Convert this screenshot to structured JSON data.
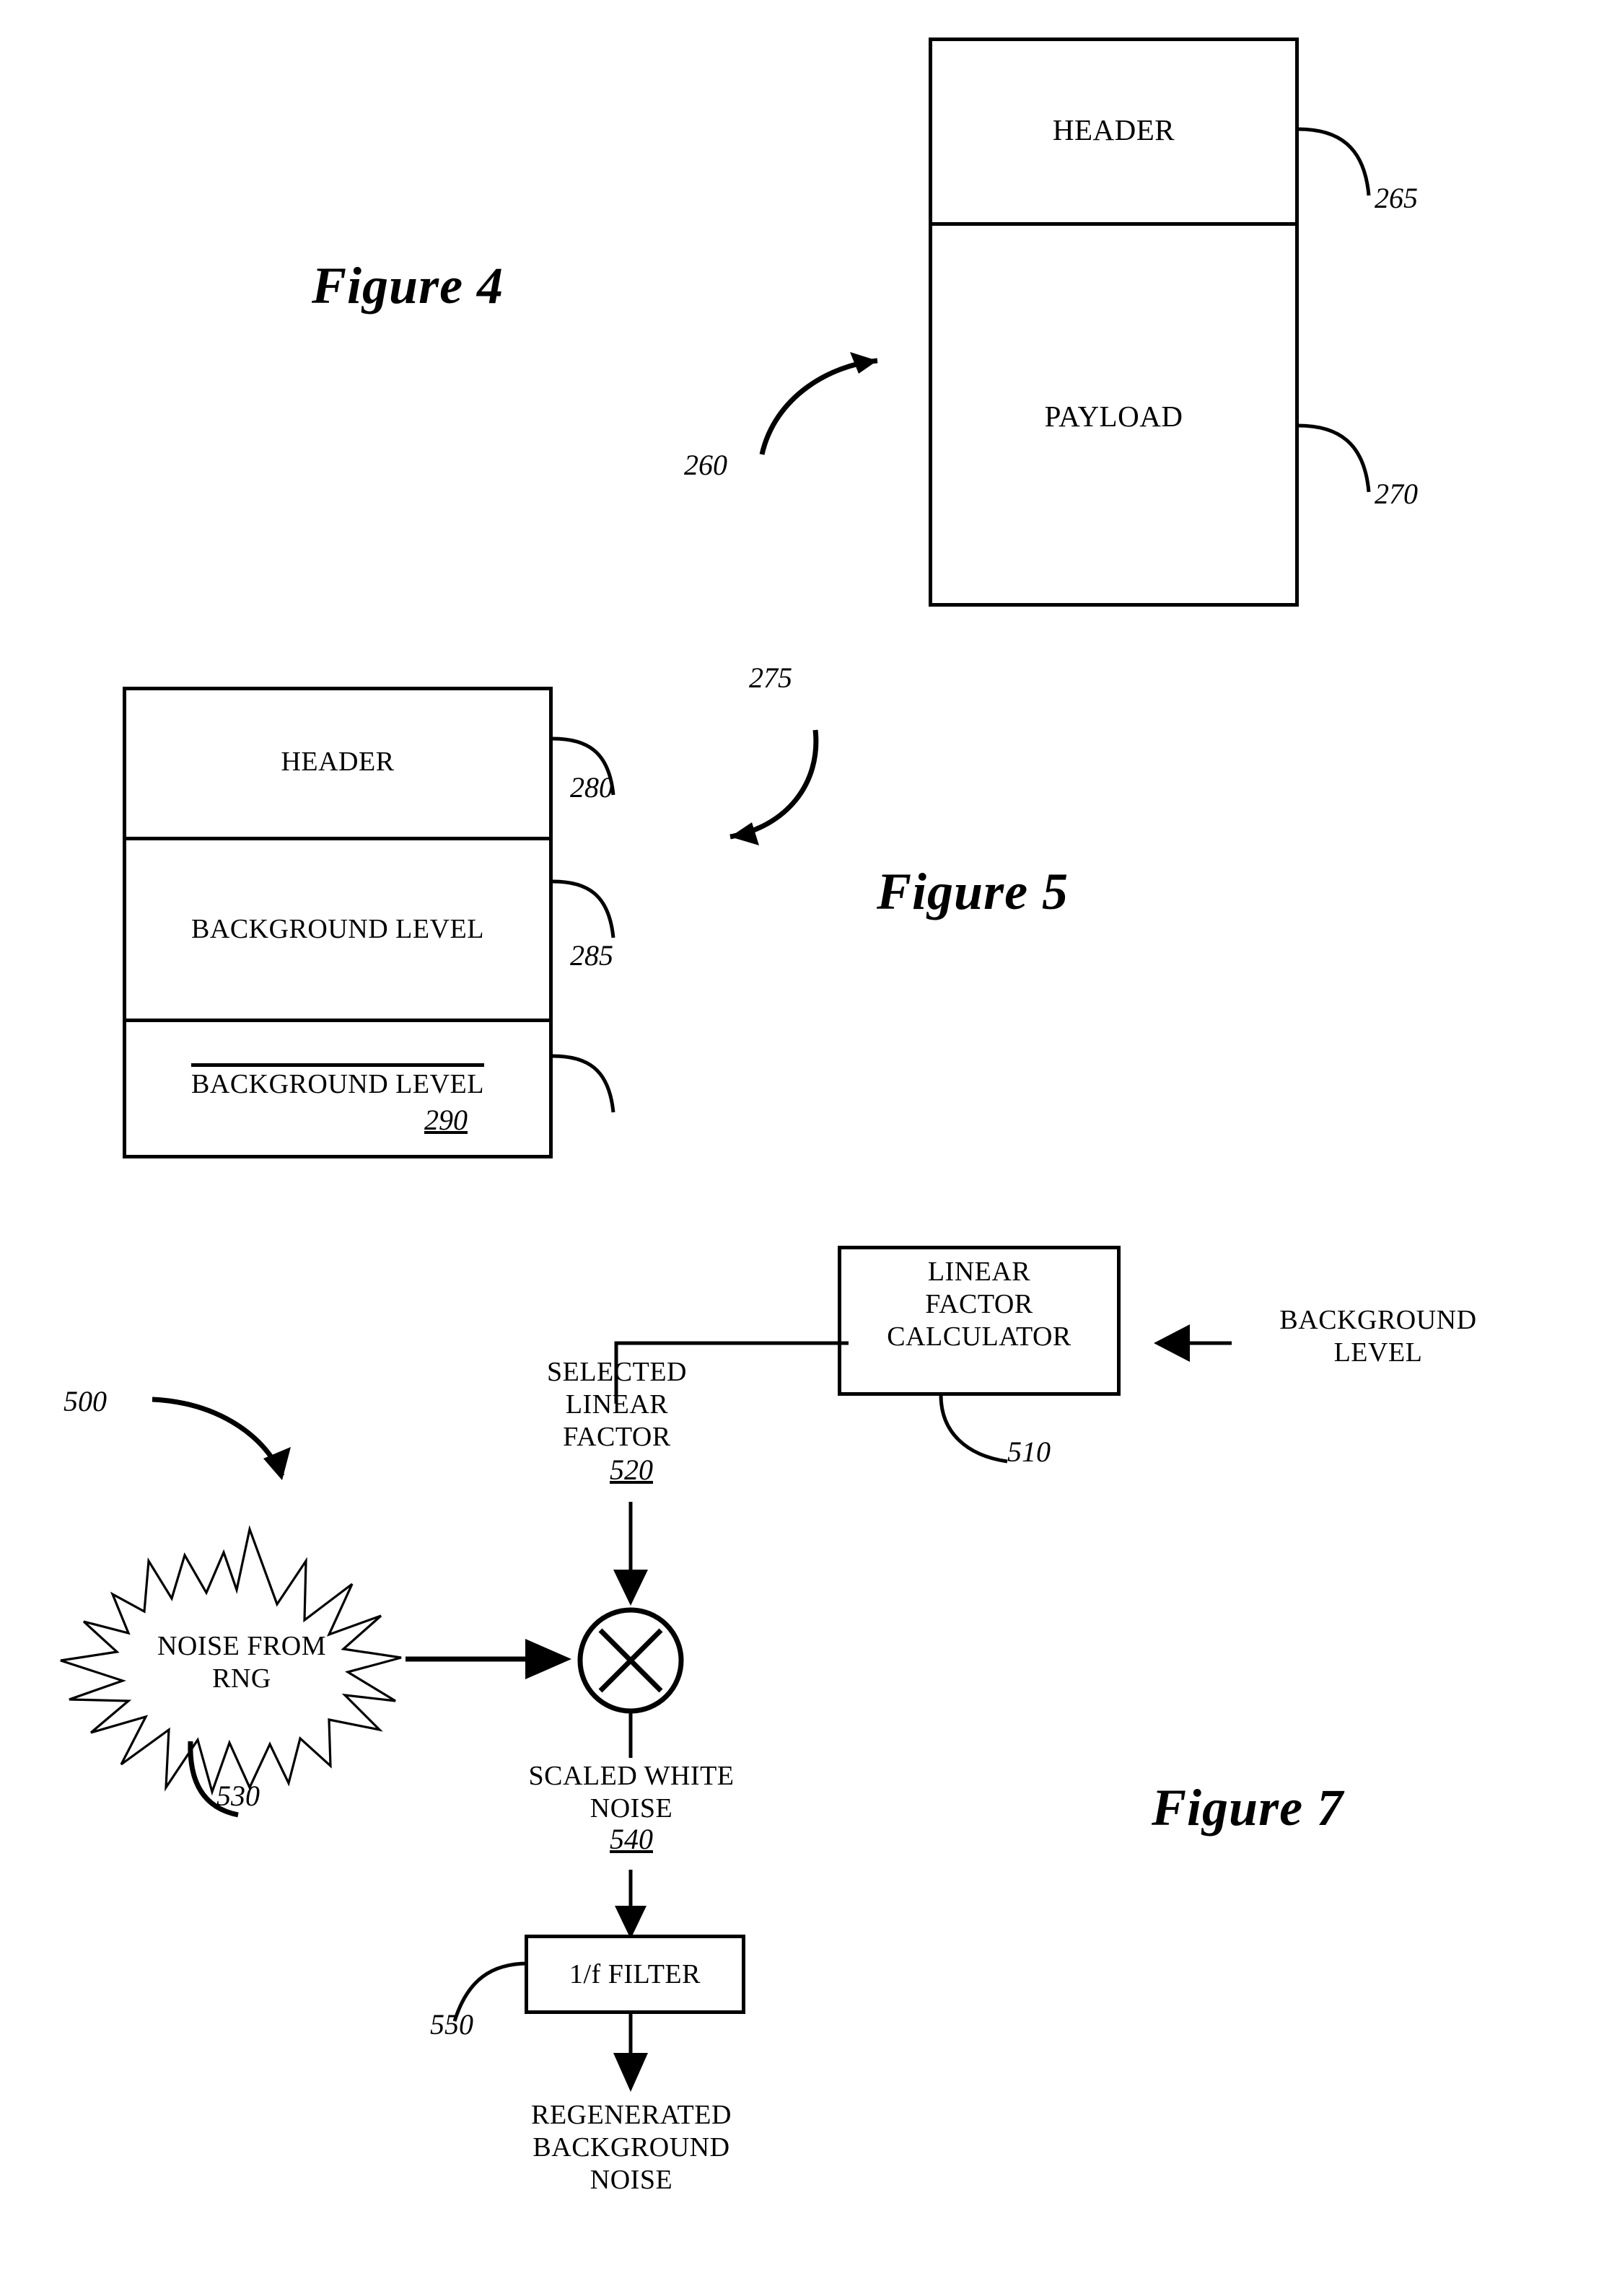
{
  "figures": [
    {
      "id": "figure-4",
      "caption": "Figure 4",
      "assembly_ref": "260",
      "sections": [
        {
          "label": "HEADER",
          "ref": "265"
        },
        {
          "label": "PAYLOAD",
          "ref": "270"
        }
      ]
    },
    {
      "id": "figure-5",
      "caption": "Figure 5",
      "assembly_ref": "275",
      "sections": [
        {
          "label": "HEADER",
          "ref": "280",
          "overline": false
        },
        {
          "label": "BACKGROUND LEVEL",
          "ref": "285",
          "overline": false
        },
        {
          "label": "BACKGROUND LEVEL",
          "ref": "290",
          "overline": true
        }
      ]
    },
    {
      "id": "figure-7",
      "caption": "Figure 7",
      "assembly_ref": "500",
      "nodes": [
        {
          "name": "linear-factor-calculator",
          "label_lines": [
            "LINEAR",
            "FACTOR",
            "CALCULATOR"
          ],
          "ref": "510",
          "shape": "rect"
        },
        {
          "name": "background-level-input",
          "label_lines": [
            "BACKGROUND",
            "LEVEL"
          ],
          "ref": "",
          "shape": "text"
        },
        {
          "name": "selected-linear-factor",
          "label_lines": [
            "SELECTED",
            "LINEAR",
            "FACTOR"
          ],
          "ref": "520",
          "shape": "text"
        },
        {
          "name": "noise-from-rng",
          "label_lines": [
            "NOISE FROM",
            "RNG"
          ],
          "ref": "530",
          "shape": "starburst"
        },
        {
          "name": "multiplier",
          "label_lines": [
            "×"
          ],
          "ref": "",
          "shape": "circle-x"
        },
        {
          "name": "scaled-white-noise",
          "label_lines": [
            "SCALED WHITE",
            "NOISE"
          ],
          "ref": "540",
          "shape": "text"
        },
        {
          "name": "one-over-f-filter",
          "label_lines": [
            "1/f FILTER"
          ],
          "ref": "550",
          "shape": "rect"
        },
        {
          "name": "regenerated-background-noise",
          "label_lines": [
            "REGENERATED",
            "BACKGROUND",
            "NOISE"
          ],
          "ref": "",
          "shape": "text"
        }
      ]
    }
  ],
  "text": {
    "fig4_caption": "Figure 4",
    "fig4_ref_assembly": "260",
    "fig4_header": "HEADER",
    "fig4_header_ref": "265",
    "fig4_payload": "PAYLOAD",
    "fig4_payload_ref": "270",
    "fig5_caption": "Figure 5",
    "fig5_ref_assembly": "275",
    "fig5_header": "HEADER",
    "fig5_header_ref": "280",
    "fig5_bglevel": "BACKGROUND LEVEL",
    "fig5_bglevel_ref": "285",
    "fig5_bglevel_mean": "BACKGROUND LEVEL",
    "fig5_bglevel_mean_ref": "290",
    "fig7_caption": "Figure 7",
    "fig7_ref_assembly": "500",
    "fig7_lfc_line1": "LINEAR",
    "fig7_lfc_line2": "FACTOR",
    "fig7_lfc_line3": "CALCULATOR",
    "fig7_lfc_ref": "510",
    "fig7_bg_line1": "BACKGROUND",
    "fig7_bg_line2": "LEVEL",
    "fig7_slf_line1": "SELECTED",
    "fig7_slf_line2": "LINEAR",
    "fig7_slf_line3": "FACTOR",
    "fig7_slf_ref": "520",
    "fig7_rng_line1": "NOISE FROM",
    "fig7_rng_line2": "RNG",
    "fig7_rng_ref": "530",
    "fig7_swn_line1": "SCALED WHITE",
    "fig7_swn_line2": "NOISE",
    "fig7_swn_ref": "540",
    "fig7_filter": "1/f FILTER",
    "fig7_filter_ref": "550",
    "fig7_out_line1": "REGENERATED",
    "fig7_out_line2": "BACKGROUND",
    "fig7_out_line3": "NOISE"
  },
  "colors": {
    "ink": "#000000",
    "paper": "#ffffff"
  }
}
